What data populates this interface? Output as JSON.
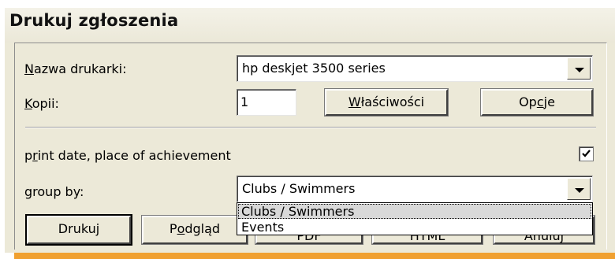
{
  "dialog": {
    "title": "Drukuj zgłoszenia"
  },
  "printer": {
    "label_mnemonic": "N",
    "label_rest": "azwa drukarki:",
    "value": "hp deskjet 3500 series"
  },
  "copies": {
    "label_mnemonic": "K",
    "label_rest": "opii:",
    "value": "1"
  },
  "buttons": {
    "properties_mn": "W",
    "properties_rest": "łaściwości",
    "options_pre": "Op",
    "options_mn": "c",
    "options_post": "je",
    "print": "Drukuj",
    "preview_pre": "P",
    "preview_mn": "o",
    "preview_post": "dgląd",
    "pdf_partial": "PDF",
    "html_partial": "HTML",
    "finish_partial": "Anuluj"
  },
  "print_date": {
    "label_pre": "p",
    "label_mn": "r",
    "label_post": "int date, place of achievement",
    "checked": true
  },
  "group_by": {
    "label": "group by:",
    "value": "Clubs / Swimmers",
    "options": [
      "Clubs / Swimmers",
      "Events"
    ],
    "selected_index": 0
  },
  "colors": {
    "accent": "#f0a030",
    "dialog_bg": "#ece9d8"
  }
}
